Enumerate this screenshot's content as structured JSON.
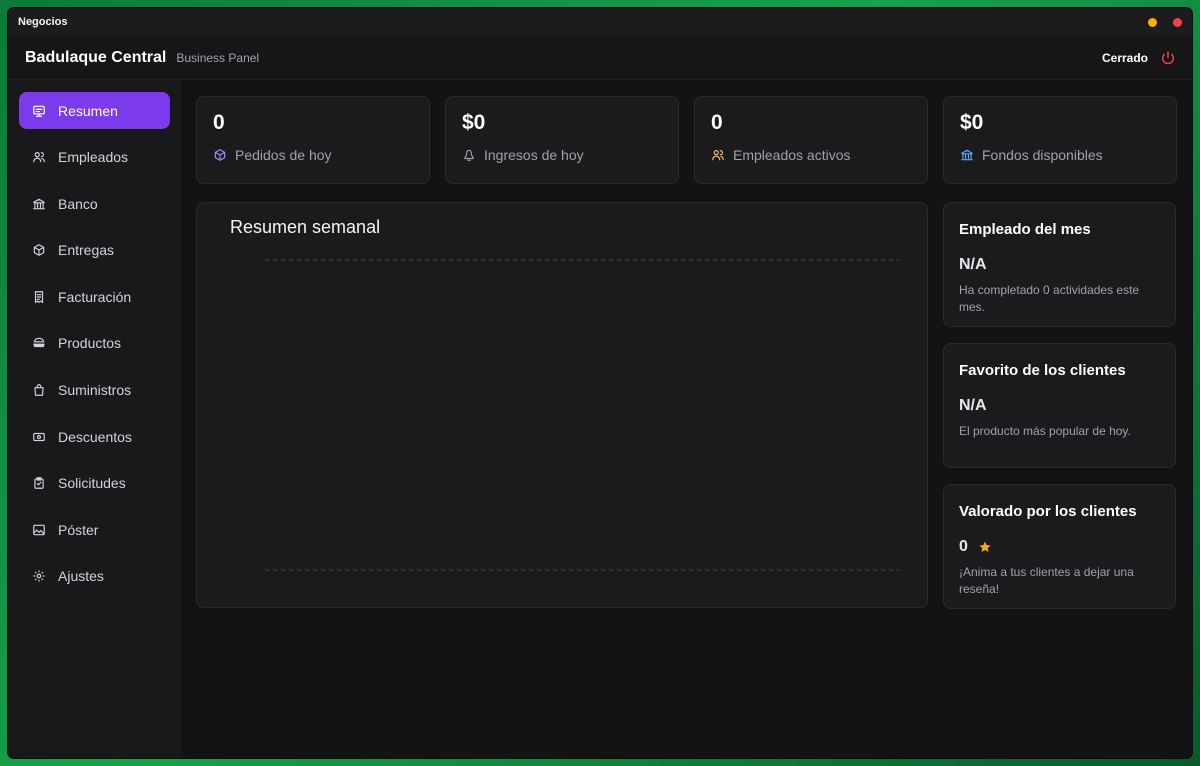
{
  "window": {
    "title": "Negocios"
  },
  "header": {
    "brand": "Badulaque Central",
    "subtitle": "Business Panel",
    "status": "Cerrado"
  },
  "colors": {
    "accent": "#7c3aed",
    "power": "#ef4444",
    "star": "#f5a623"
  },
  "sidebar": {
    "items": [
      {
        "label": "Resumen",
        "icon": "dashboard-icon"
      },
      {
        "label": "Empleados",
        "icon": "users-icon"
      },
      {
        "label": "Banco",
        "icon": "bank-icon"
      },
      {
        "label": "Entregas",
        "icon": "package-icon"
      },
      {
        "label": "Facturación",
        "icon": "receipt-icon"
      },
      {
        "label": "Productos",
        "icon": "burger-icon"
      },
      {
        "label": "Suministros",
        "icon": "shopping-bag-icon"
      },
      {
        "label": "Descuentos",
        "icon": "ticket-icon"
      },
      {
        "label": "Solicitudes",
        "icon": "clipboard-icon"
      },
      {
        "label": "Póster",
        "icon": "image-icon"
      },
      {
        "label": "Ajustes",
        "icon": "gear-icon"
      }
    ]
  },
  "stats": [
    {
      "value": "0",
      "label": "Pedidos de hoy",
      "icon": "box-icon"
    },
    {
      "value": "$0",
      "label": "Ingresos de hoy",
      "icon": "money-icon"
    },
    {
      "value": "0",
      "label": "Empleados activos",
      "icon": "users-icon"
    },
    {
      "value": "$0",
      "label": "Fondos disponibles",
      "icon": "bank-icon"
    }
  ],
  "chart": {
    "title": "Resumen semanal"
  },
  "cards": {
    "employee": {
      "heading": "Empleado del mes",
      "value": "N/A",
      "desc": "Ha completado 0 actividades este mes."
    },
    "favorite": {
      "heading": "Favorito de los clientes",
      "value": "N/A",
      "desc": "El producto más popular de hoy."
    },
    "rated": {
      "heading": "Valorado por los clientes",
      "value": "0",
      "desc": "¡Anima a tus clientes a dejar una reseña!"
    }
  }
}
